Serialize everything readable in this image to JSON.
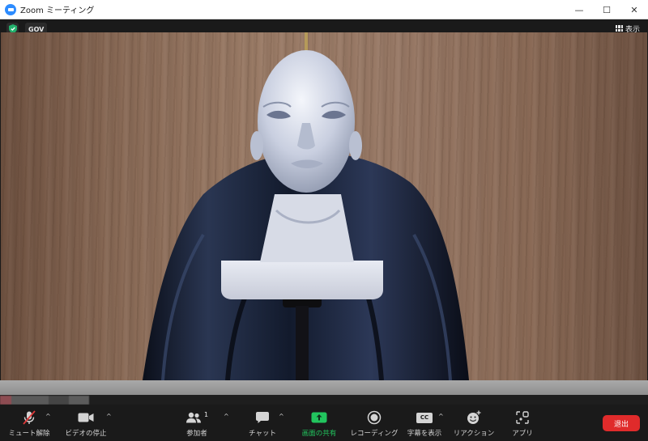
{
  "window": {
    "title": "Zoom ミーティング",
    "minimize": "—",
    "maximize": "☐",
    "close": "✕"
  },
  "top": {
    "badge": "GOV",
    "view_label": "表示"
  },
  "toolbar": {
    "mute_label": "ミュート解除",
    "video_label": "ビデオの停止",
    "participants_label": "参加者",
    "participants_count": "1",
    "chat_label": "チャット",
    "share_label": "画面の共有",
    "record_label": "レコーディング",
    "captions_label": "字幕を表示",
    "captions_badge": "CC",
    "reactions_label": "リアクション",
    "apps_label": "アプリ",
    "leave_label": "退出",
    "caret": "^"
  },
  "colors": {
    "accent": "#2d8cff",
    "share_green": "#22c55e",
    "leave_red": "#e02b2b",
    "muted_red": "#e03a3a",
    "secure_green": "#23b26d"
  }
}
